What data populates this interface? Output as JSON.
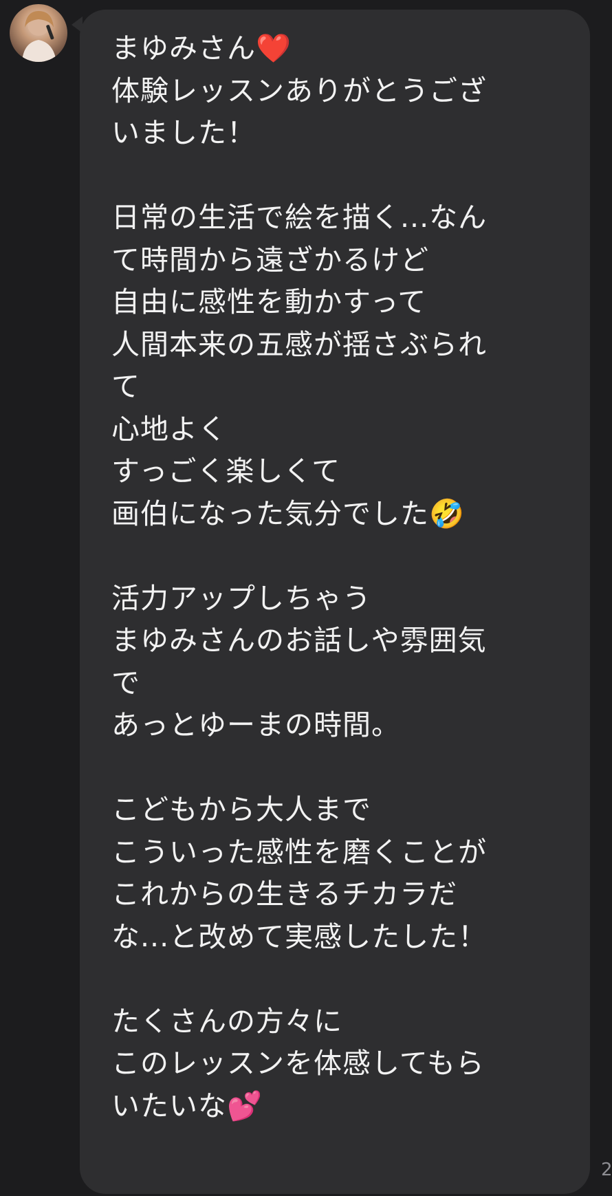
{
  "chat": {
    "message": {
      "text": "まゆみさん❤️\n体験レッスンありがとうござ\nいました！\n\n日常の生活で絵を描く...なん\nて時間から遠ざかるけど\n自由に感性を動かすって\n人間本来の五感が揺さぶられ\nて\n心地よく\nすっごく楽しくて\n画伯になった気分でした🤣\n\n活力アップしちゃう\nまゆみさんのお話しや雰囲気\nで\nあっとゆーまの時間。\n\nこどもから大人まで\nこういった感性を磨くことが\nこれからの生きるチカラだ\nな...と改めて実感したした！\n\nたくさんの方々に\nこのレッスンを体感してもら\nいたいな💕",
      "timestamp": "2"
    },
    "colors": {
      "background": "#1c1c1e",
      "bubble": "#2e2e30",
      "text": "#f2f2f2",
      "timestamp": "#8e8e93"
    }
  }
}
